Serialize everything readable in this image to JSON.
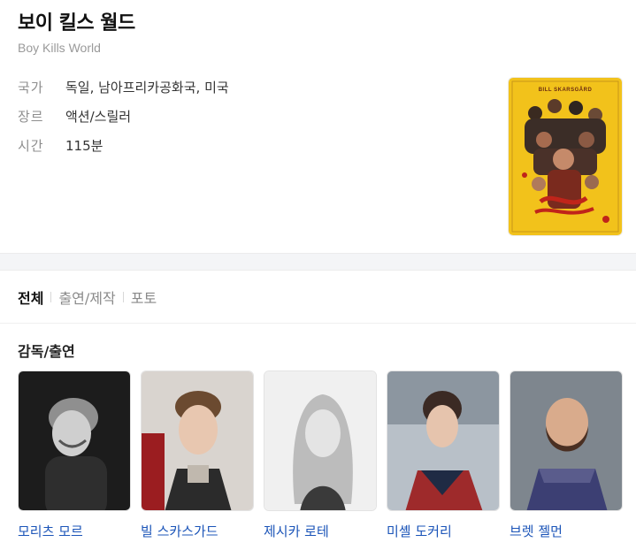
{
  "movie": {
    "title": "보이 킬스 월드",
    "original_title": "Boy Kills World",
    "info": [
      {
        "key": "국가",
        "value": "독일, 남아프리카공화국, 미국"
      },
      {
        "key": "장르",
        "value": "액션/스릴러"
      },
      {
        "key": "시간",
        "value": "115분"
      }
    ],
    "poster": {
      "top_text": "BILL SKARSGÅRD",
      "accent": "#f2c21b"
    }
  },
  "tabs": [
    {
      "label": "전체",
      "active": true
    },
    {
      "label": "출연/제작",
      "active": false
    },
    {
      "label": "포토",
      "active": false
    }
  ],
  "section": {
    "title": "감독/출연"
  },
  "cast": [
    {
      "name": "모리츠 모르"
    },
    {
      "name": "빌 스카스가드"
    },
    {
      "name": "제시카 로테"
    },
    {
      "name": "미셸 도커리"
    },
    {
      "name": "브렛 젤먼"
    }
  ],
  "colors": {
    "link": "#1b54b8",
    "muted": "#8e8e8e",
    "band": "#f4f5f7"
  }
}
